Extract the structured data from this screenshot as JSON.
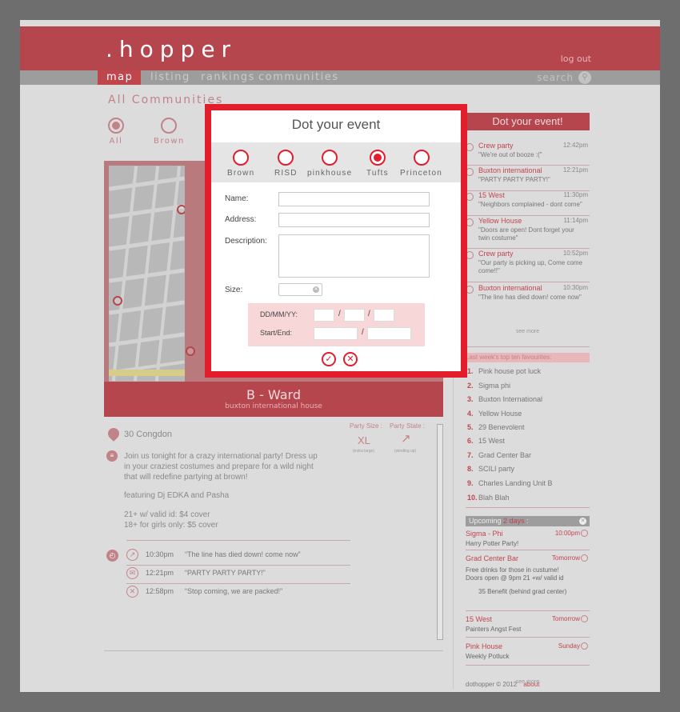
{
  "app": {
    "logo": ".hopper",
    "logout": "log out"
  },
  "nav": {
    "items": [
      "map",
      "listing",
      "rankings",
      "communities"
    ],
    "search": "search"
  },
  "communities": {
    "title": "All Communities",
    "tabs": [
      "All",
      "Brown"
    ]
  },
  "place": {
    "name": "B - Ward",
    "subtitle": "buxton international house",
    "address": "30 Congdon",
    "description": "Join us tonight for a crazy international party! Dress up in your craziest costumes and prepare for a wild night that will redefine partying at brown!",
    "featuring": "featuring Dj EDKA and Pasha",
    "cover1": "21+ w/ valid id: $4 cover",
    "cover2": "18+ for girls only: $5 cover",
    "party_size_label": "Party Size :",
    "party_size": "XL",
    "party_size_note": "(extra large)",
    "party_state_label": "Party State :",
    "party_state_icon": "↗",
    "party_state_note": "(winding up)",
    "feed": [
      {
        "time": "10:30pm",
        "msg": "“The line has died down! come now”",
        "icon": "↗"
      },
      {
        "time": "12:21pm",
        "msg": "“PARTY PARTY PARTY!”",
        "icon": "✉"
      },
      {
        "time": "12:58pm",
        "msg": "“Stop coming, we are packed!”",
        "icon": "✕"
      }
    ]
  },
  "right": {
    "title": "Dot your event!",
    "events": [
      {
        "name": "Crew party",
        "time": "12:42pm",
        "msg": "\"We're out of booze :(\""
      },
      {
        "name": "Buxton international",
        "time": "12:21pm",
        "msg": "\"PARTY PARTY PARTY!\""
      },
      {
        "name": "15 West",
        "time": "11:30pm",
        "msg": "\"Neighbors complained - dont come\""
      },
      {
        "name": "Yellow House",
        "time": "11:14pm",
        "msg": "\"Doors are open! Dont forget your twin costume\""
      },
      {
        "name": "Crew party",
        "time": "10:52pm",
        "msg": "\"Our party is picking up, Come come come!!\""
      },
      {
        "name": "Buxton international",
        "time": "10:30pm",
        "msg": "\"The line has died down! come now\""
      }
    ],
    "see_more": "see more",
    "fav_title": "Last week's top ten favourites:",
    "favs": [
      "Pink house pot luck",
      "Sigma phi",
      "Buxton International",
      "Yellow House",
      "29 Benevolent",
      "15 West",
      "Grad Center Bar",
      "SCILI party",
      "Charles Landing Unit B",
      "Blah Blah"
    ],
    "upcoming_label": "Upcoming",
    "upcoming_days": "2 days",
    "upcoming_colon": ":",
    "upcoming": [
      {
        "name": "Sigma - Phi",
        "when": "10:00pm",
        "desc": "Harry Potter Party!"
      },
      {
        "name": "Grad Center Bar",
        "when": "Tomorrow",
        "desc": "Free drinks for those in custume! Doors open @ 9pm 21 +w/ valid id",
        "addr": "35 Benefit (behind grad center)"
      },
      {
        "name": "15 West",
        "when": "Tomorrow",
        "desc": "Painters Angst Fest"
      },
      {
        "name": "Pink House",
        "when": "Sunday",
        "desc": "Weekly Potluck"
      }
    ],
    "see_more2": "see more"
  },
  "footer": {
    "copy": "dothopper © 2012",
    "about": "about"
  },
  "modal": {
    "title": "Dot your event",
    "tabs": [
      "Brown",
      "RISD",
      "pinkhouse",
      "Tufts",
      "Princeton"
    ],
    "selected_tab": "Tufts",
    "name_label": "Name:",
    "address_label": "Address:",
    "description_label": "Description:",
    "size_label": "Size:",
    "date_label": "DD/MM/YY:",
    "startend_label": "Start/End:",
    "slash": "/",
    "confirm_icon": "✓",
    "cancel_icon": "✕"
  },
  "colors": {
    "brand": "#b5464e",
    "accent": "#e21d2c",
    "nav": "#9d9d9d"
  }
}
